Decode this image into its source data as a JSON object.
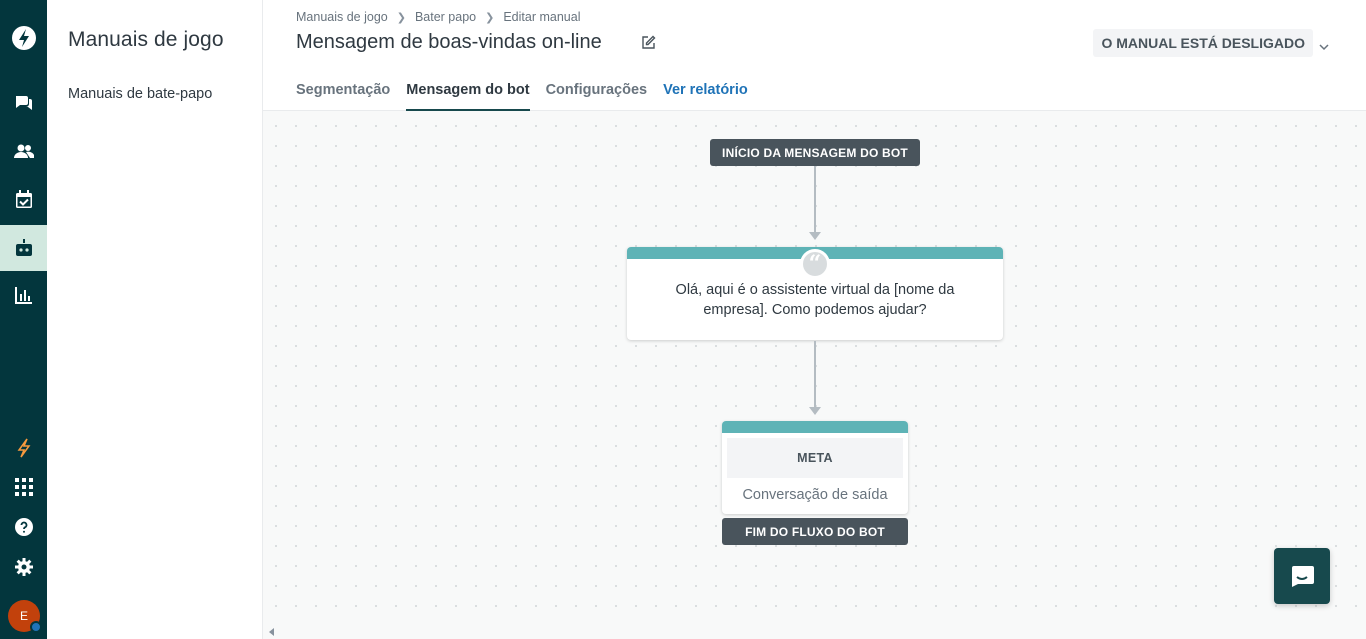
{
  "rail": {
    "items": [
      "logo-icon",
      "chat-icon",
      "users-icon",
      "calendar-check-icon",
      "bot-icon",
      "reports-icon"
    ],
    "bottom": [
      "lightning-icon",
      "apps-grid-icon",
      "help-icon",
      "settings-icon"
    ],
    "avatar_initial": "E",
    "active_color": "#d1e8df"
  },
  "subnav": {
    "title": "Manuais de jogo",
    "items": [
      "Manuais de bate-papo"
    ]
  },
  "header": {
    "breadcrumb": [
      "Manuais de jogo",
      "Bater papo",
      "Editar manual"
    ],
    "title": "Mensagem de boas-vindas on-line",
    "status": "O MANUAL ESTÁ DESLIGADO",
    "tabs": [
      "Segmentação",
      "Mensagem do bot",
      "Configurações",
      "Ver relatório"
    ]
  },
  "flow": {
    "start_label": "INÍCIO DA MENSAGEM DO BOT",
    "message": "Olá, aqui é o assistente virtual da [nome da empresa]. Como podemos ajudar?",
    "goal_label": "META",
    "goal_value": "Conversação de saída",
    "end_label": "FIM DO FLUXO DO BOT",
    "accent_color": "#5eb3b6"
  }
}
